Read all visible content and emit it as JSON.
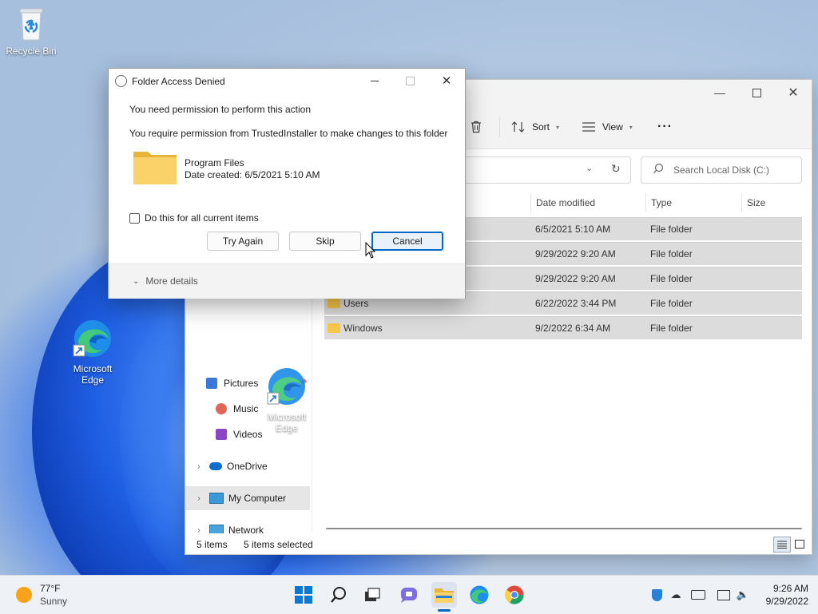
{
  "desktop": {
    "recycle_bin_label": "Recycle Bin",
    "edge_label_line1": "Microsoft",
    "edge_label_line2": "Edge",
    "edge_drag_label_line1": "Microsoft",
    "edge_drag_label_line2": "Edge"
  },
  "dialog": {
    "title": "Folder Access Denied",
    "heading": "You need permission to perform this action",
    "message": "You require permission from TrustedInstaller to make changes to this folder",
    "item_name": "Program Files",
    "item_date": "Date created: 6/5/2021 5:10 AM",
    "checkbox_label": "Do this for all current items",
    "checkbox_checked": false,
    "try_again_label": "Try Again",
    "skip_label": "Skip",
    "cancel_label": "Cancel",
    "more_details_label": "More details"
  },
  "explorer": {
    "toolbar": {
      "sort_label": "Sort",
      "view_label": "View",
      "more_label": "···"
    },
    "search_placeholder": "Search Local Disk (C:)",
    "columns": {
      "date": "Date modified",
      "type": "Type",
      "size": "Size"
    },
    "rows": [
      {
        "name": "",
        "date": "6/5/2021 5:10 AM",
        "type": "File folder"
      },
      {
        "name": "",
        "date": "9/29/2022 9:20 AM",
        "type": "File folder"
      },
      {
        "name": "",
        "date": "9/29/2022 9:20 AM",
        "type": "File folder"
      },
      {
        "name": "Users",
        "date": "6/22/2022 3:44 PM",
        "type": "File folder"
      },
      {
        "name": "Windows",
        "date": "9/2/2022 6:34 AM",
        "type": "File folder"
      }
    ],
    "nav": {
      "pictures": "Pictures",
      "music": "Music",
      "videos": "Videos",
      "onedrive": "OneDrive",
      "my_computer": "My Computer",
      "network": "Network"
    },
    "status": {
      "items": "5 items",
      "selected": "5 items selected"
    }
  },
  "taskbar": {
    "weather_temp": "77°F",
    "weather_desc": "Sunny",
    "time": "9:26 AM",
    "date": "9/29/2022"
  },
  "colors": {
    "accent": "#0067c0",
    "folder": "#f7c948",
    "taskbar": "#eef1f6"
  }
}
